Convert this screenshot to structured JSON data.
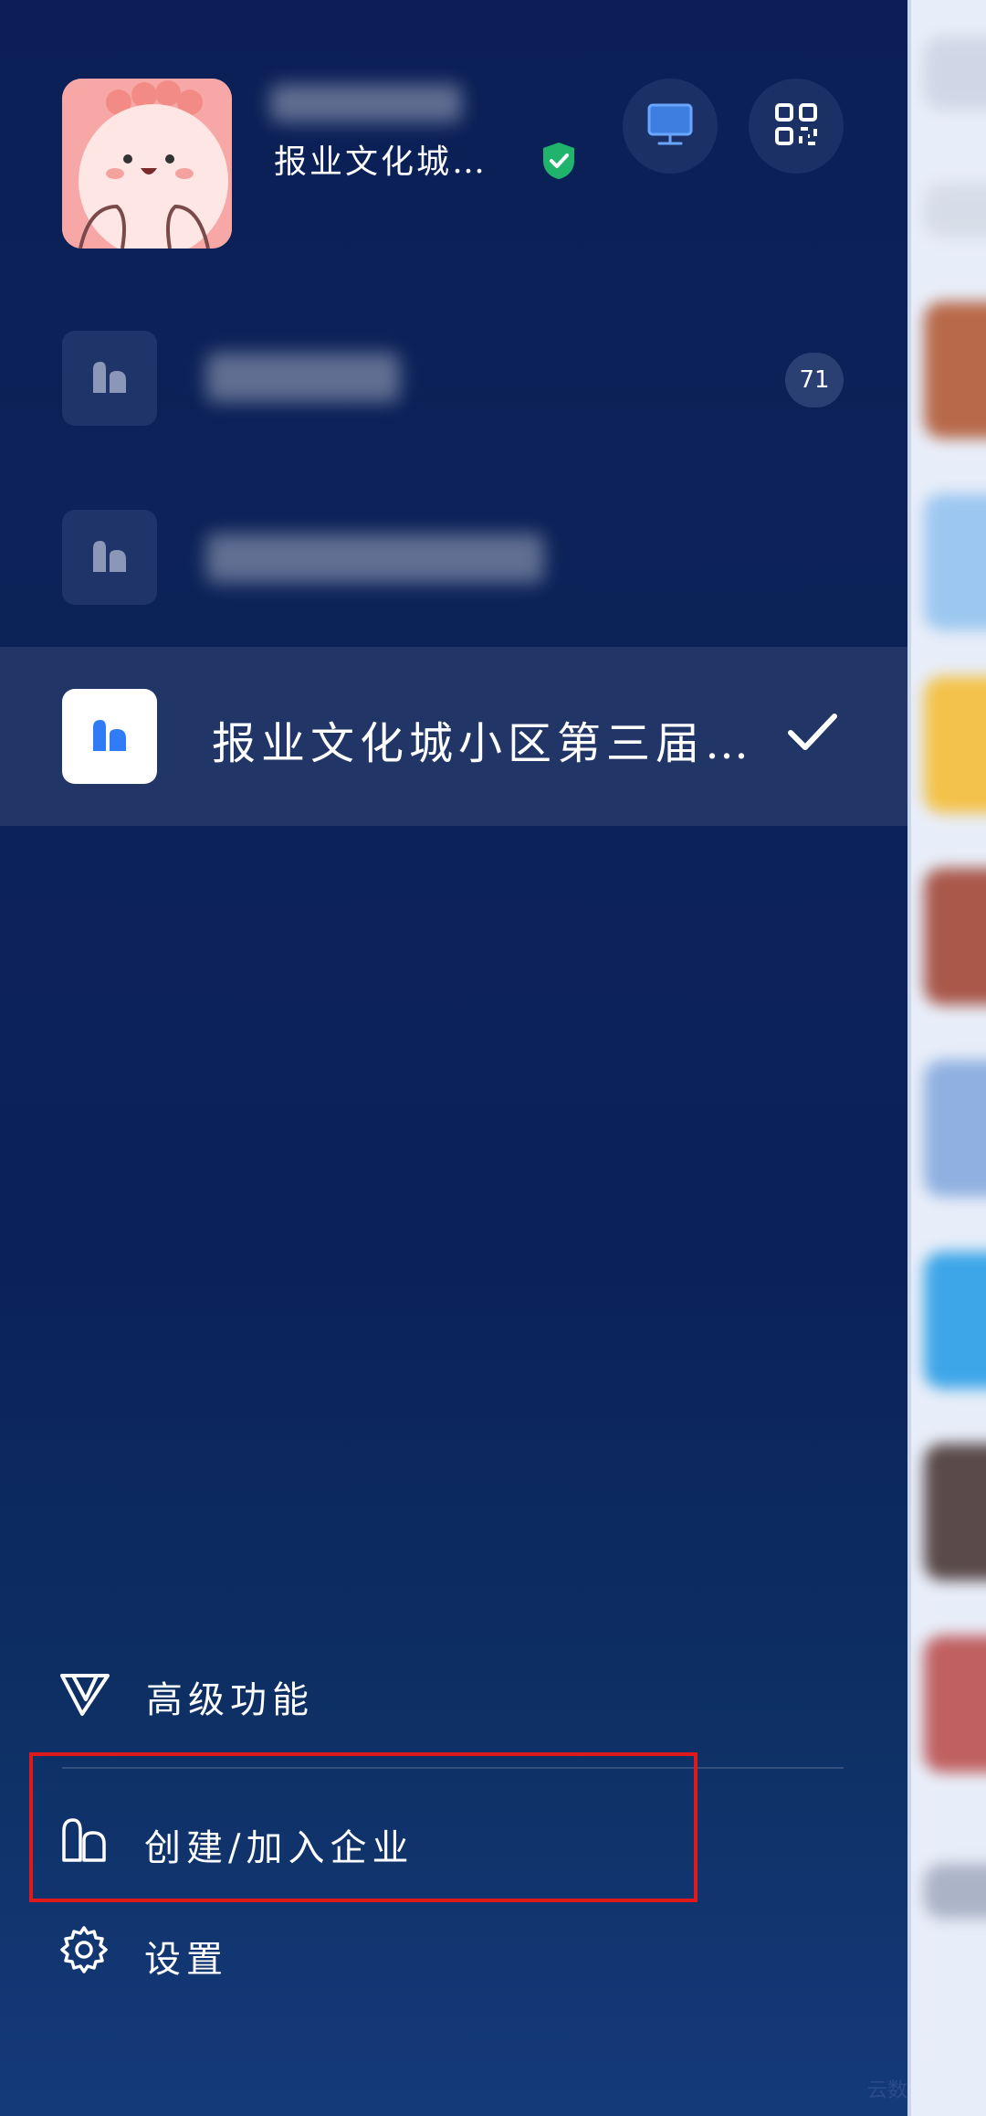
{
  "profile": {
    "org_name_short": "报业文化城…",
    "verified_icon": "shield-check-icon"
  },
  "header_buttons": {
    "desktop_icon": "monitor-icon",
    "qr_icon": "qr-code-icon"
  },
  "orgs": [
    {
      "icon": "building-icon",
      "badge": "71"
    },
    {
      "icon": "building-icon"
    },
    {
      "icon": "building-icon",
      "label": "报业文化城小区第三届…",
      "selected": true
    }
  ],
  "menu": {
    "advanced": "高级功能",
    "create_join": "创建/加入企业",
    "settings": "设置"
  },
  "watermark": "云数",
  "colors": {
    "accent_blue": "#2f7cf6",
    "verified_green": "#1fb36b",
    "highlight_red": "#e01a1a"
  }
}
